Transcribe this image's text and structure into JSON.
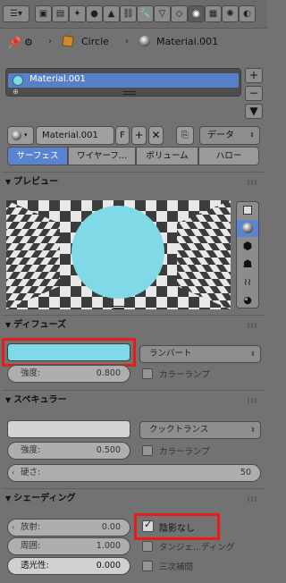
{
  "header": {
    "icons": [
      "editor-type-icon",
      "render-icon",
      "render-layers-icon",
      "scene-icon",
      "world-icon",
      "object-icon",
      "constraints-icon",
      "modifiers-icon",
      "data-icon",
      "material-icon",
      "texture-icon",
      "particles-icon",
      "physics-icon"
    ],
    "active_icon": "material-icon"
  },
  "breadcrumb": {
    "object_name": "Circle",
    "material_name": "Material.001"
  },
  "slots": {
    "items": [
      "Material.001"
    ]
  },
  "datablock": {
    "name": "Material.001",
    "fake_user": "F",
    "link_mode": "データ"
  },
  "tabs": [
    {
      "label": "サーフェス",
      "active": true
    },
    {
      "label": "ワイヤーフ...",
      "active": false
    },
    {
      "label": "ボリューム",
      "active": false
    },
    {
      "label": "ハロー",
      "active": false
    }
  ],
  "preview": {
    "title": "プレビュー",
    "sphere_color": "#80d9e6"
  },
  "diffuse": {
    "title": "ディフューズ",
    "color": "#80d9e6",
    "shader": "ランバート",
    "intensity_label": "強度:",
    "intensity_value": "0.800",
    "ramp_label": "カラーランプ"
  },
  "specular": {
    "title": "スペキュラー",
    "color": "#d4d4d4",
    "shader": "クックトランス",
    "intensity_label": "強度:",
    "intensity_value": "0.500",
    "ramp_label": "カラーランプ",
    "hardness_label": "硬さ:",
    "hardness_value": "50"
  },
  "shading": {
    "title": "シェーディング",
    "emit_label": "放射:",
    "emit_value": "0.00",
    "ambient_label": "周囲:",
    "ambient_value": "1.000",
    "translucency_label": "透光性:",
    "translucency_value": "0.000",
    "shadeless_label": "陰影なし",
    "shadeless_checked": true,
    "tangent_label": "タンジェ...ディング",
    "cubic_label": "三次補間"
  },
  "colors": {
    "accent": "#5a84d0",
    "highlight": "#e81a1a"
  }
}
